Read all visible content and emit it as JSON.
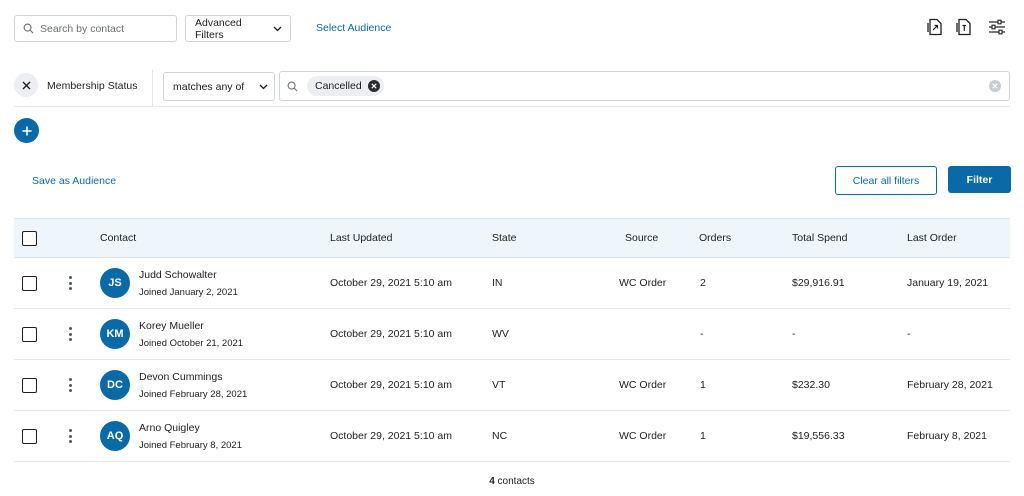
{
  "toolbar": {
    "search_placeholder": "Search by contact",
    "advanced_filters_label": "Advanced Filters",
    "select_audience_label": "Select Audience",
    "icons": [
      "export-icon",
      "import-icon",
      "settings-sliders-icon"
    ]
  },
  "filter": {
    "field_label": "Membership Status",
    "operator_value": "matches any of",
    "chips": [
      "Cancelled"
    ]
  },
  "actions": {
    "save_audience": "Save as Audience",
    "clear_all_filters": "Clear all filters",
    "filter": "Filter"
  },
  "table": {
    "headers": {
      "contact": "Contact",
      "last_updated": "Last Updated",
      "state": "State",
      "source": "Source",
      "orders": "Orders",
      "total_spend": "Total Spend",
      "last_order": "Last Order"
    },
    "rows": [
      {
        "initials": "JS",
        "name": "Judd Schowalter",
        "joined": "Joined January 2, 2021",
        "last_updated": "October 29, 2021 5:10 am",
        "state": "IN",
        "source": "WC Order",
        "orders": "2",
        "total_spend": "$29,916.91",
        "last_order": "January 19, 2021"
      },
      {
        "initials": "KM",
        "name": "Korey Mueller",
        "joined": "Joined October 21, 2021",
        "last_updated": "October 29, 2021 5:10 am",
        "state": "WV",
        "source": "",
        "orders": "-",
        "total_spend": "-",
        "last_order": "-"
      },
      {
        "initials": "DC",
        "name": "Devon Cummings",
        "joined": "Joined February 28, 2021",
        "last_updated": "October 29, 2021 5:10 am",
        "state": "VT",
        "source": "WC Order",
        "orders": "1",
        "total_spend": "$232.30",
        "last_order": "February 28, 2021"
      },
      {
        "initials": "AQ",
        "name": "Arno Quigley",
        "joined": "Joined February 8, 2021",
        "last_updated": "October 29, 2021 5:10 am",
        "state": "NC",
        "source": "WC Order",
        "orders": "1",
        "total_spend": "$19,556.33",
        "last_order": "February 8, 2021"
      }
    ]
  },
  "footer": {
    "count": "4",
    "count_label": "contacts"
  },
  "colors": {
    "accent": "#0a6aa8",
    "header_bg": "#eef5fb"
  }
}
